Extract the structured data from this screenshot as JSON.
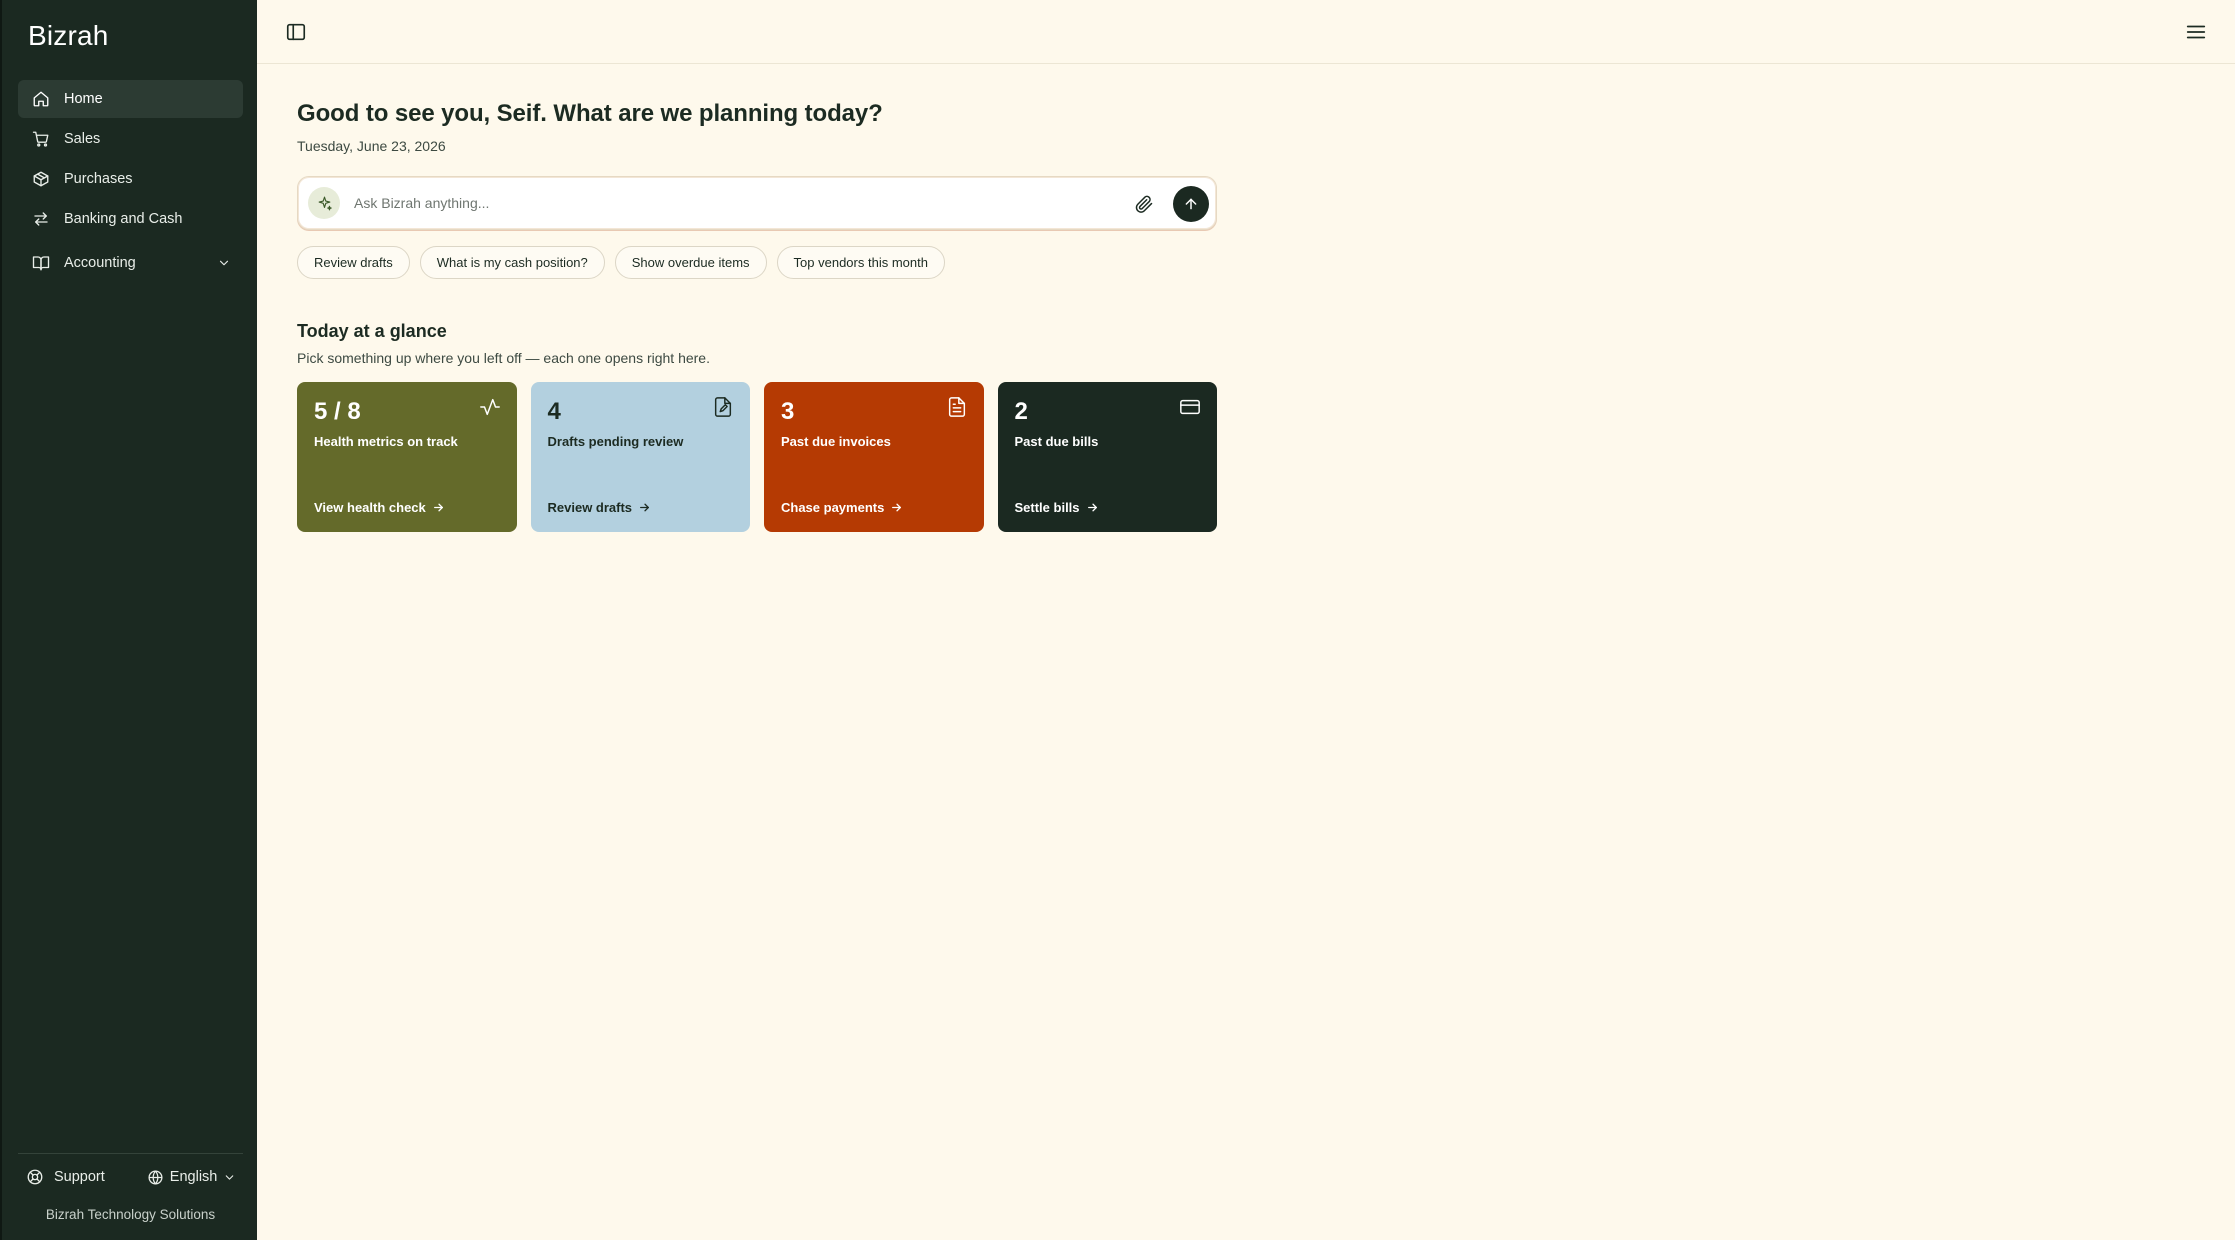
{
  "sidebar": {
    "brand": "Bizrah",
    "items": [
      {
        "label": "Home",
        "icon": "home-icon",
        "active": true
      },
      {
        "label": "Sales",
        "icon": "cart-icon"
      },
      {
        "label": "Purchases",
        "icon": "package-icon"
      },
      {
        "label": "Banking and Cash",
        "icon": "transfer-icon"
      },
      {
        "label": "Accounting",
        "icon": "book-icon",
        "expandable": true
      }
    ],
    "footer": {
      "support_label": "Support",
      "language_label": "English",
      "company": "Bizrah Technology Solutions"
    }
  },
  "header": {
    "greeting": "Good to see you, Seif. What are we planning today?",
    "date": "Tuesday, June 23, 2026"
  },
  "ask": {
    "placeholder": "Ask Bizrah anything...",
    "value": ""
  },
  "chips": [
    "Review drafts",
    "What is my cash position?",
    "Show overdue items",
    "Top vendors this month"
  ],
  "glance": {
    "title": "Today at a glance",
    "subtitle": "Pick something up where you left off — each one opens right here.",
    "cards": [
      {
        "value": "5 / 8",
        "label": "Health metrics on track",
        "action": "View health check",
        "icon": "activity-icon",
        "color": "#646a2a"
      },
      {
        "value": "4",
        "label": "Drafts pending review",
        "action": "Review drafts",
        "icon": "file-edit-icon",
        "color": "#b3d0df"
      },
      {
        "value": "3",
        "label": "Past due invoices",
        "action": "Chase payments",
        "icon": "file-text-icon",
        "color": "#b53a03"
      },
      {
        "value": "2",
        "label": "Past due bills",
        "action": "Settle bills",
        "icon": "credit-card-icon",
        "color": "#1b2921"
      }
    ]
  },
  "colors": {
    "sidebar_bg": "#1b2921",
    "page_bg": "#fef9ec",
    "accent_dark": "#1b2921"
  }
}
